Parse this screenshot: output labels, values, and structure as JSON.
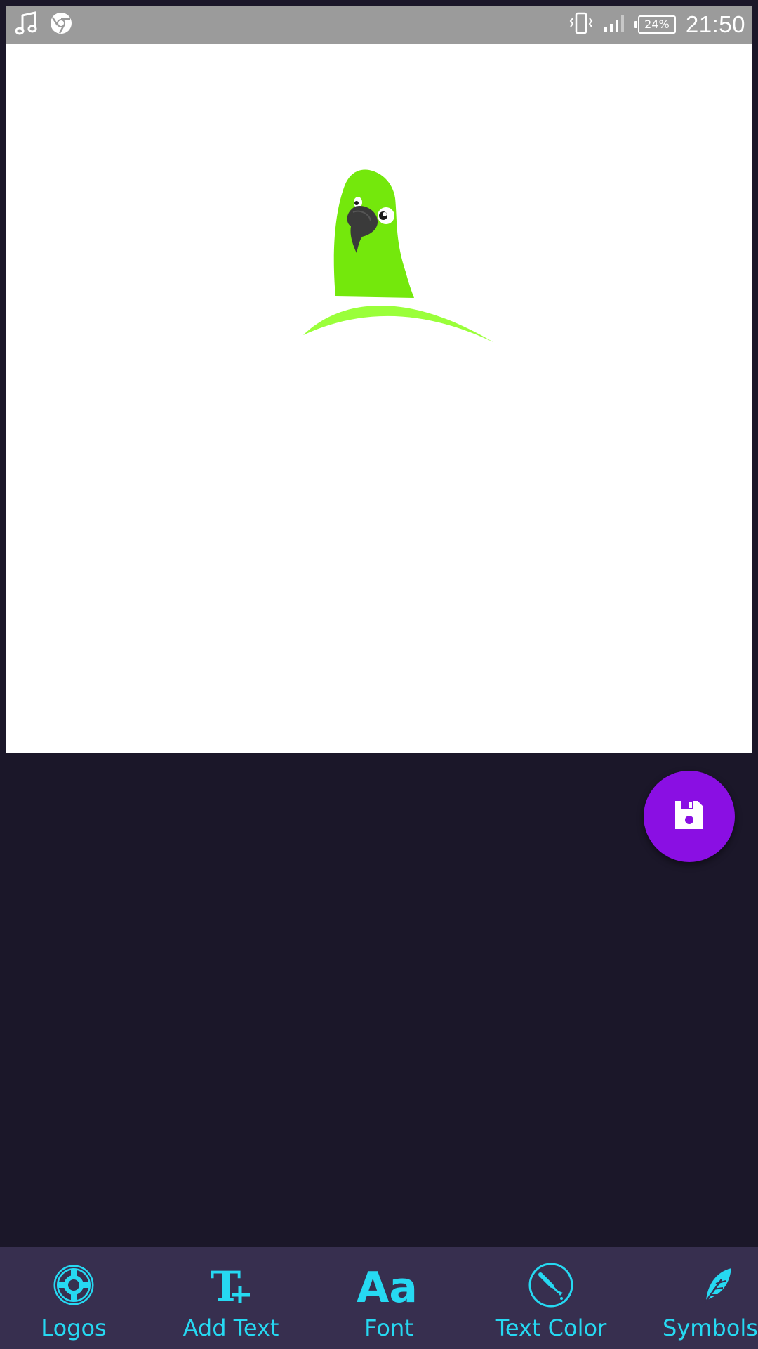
{
  "status_bar": {
    "battery_text": "24%",
    "time": "21:50",
    "left_icons": [
      "music-note-icon",
      "chrome-icon"
    ],
    "right_icons": [
      "vibrate-icon",
      "signal-icon",
      "battery-icon"
    ]
  },
  "canvas": {
    "background": "#ffffff",
    "logo_description_icon": "parrot-logo"
  },
  "fab": {
    "icon": "save-icon",
    "color": "#8a0fe3"
  },
  "toolbar": {
    "accent": "#26d9f2",
    "background": "#372f4f",
    "items": [
      {
        "label": "Logos",
        "icon": "lifebuoy-icon"
      },
      {
        "label": "Add Text",
        "icon": "text-add-icon"
      },
      {
        "label": "Font",
        "icon": "font-icon"
      },
      {
        "label": "Text Color",
        "icon": "eyedropper-icon"
      },
      {
        "label": "Symbols",
        "icon": "feather-icon"
      }
    ]
  }
}
